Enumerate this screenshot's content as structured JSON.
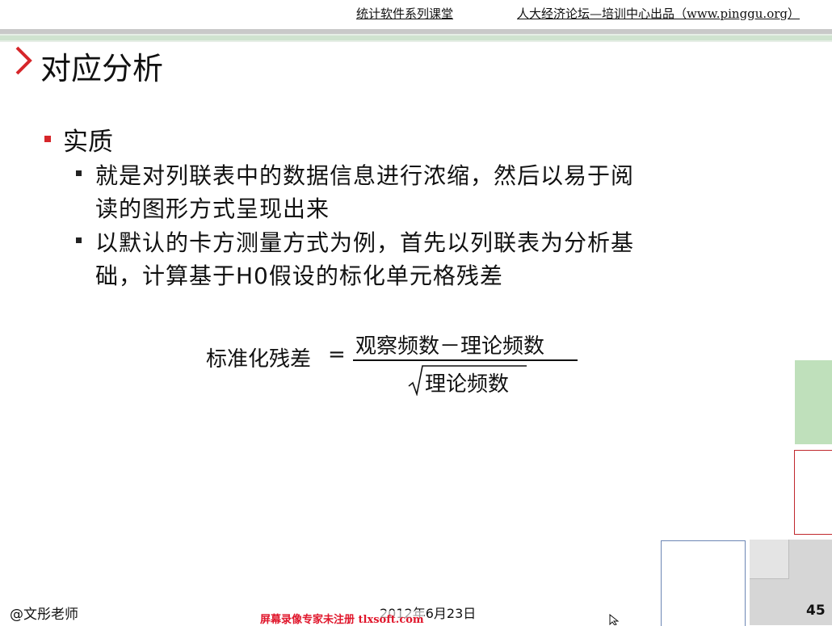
{
  "header": {
    "course": "统计软件系列课堂",
    "publisher": "人大经济论坛—培训中心出品（www.pinggu.org）"
  },
  "slide": {
    "title": "对应分析",
    "level1": [
      {
        "text": "实质"
      }
    ],
    "level2": [
      {
        "line1": "就是对列联表中的数据信息进行浓缩，然后以易于阅",
        "line2": "读的图形方式呈现出来"
      },
      {
        "line1": "以默认的卡方测量方式为例，首先以列联表为分析基",
        "line2": "础，计算基于H0假设的标化单元格残差"
      }
    ],
    "formula": {
      "lhs": "标准化残差",
      "equals": "=",
      "numerator": "观察频数－理论频数",
      "denominator": "理论频数"
    }
  },
  "footer": {
    "author": "@文彤老师",
    "date": "2012年6月23日",
    "watermark": "屏幕录像专家未注册 tlxsoft.com",
    "page": "45"
  },
  "colors": {
    "accent_red": "#d6262a",
    "stripe_gray": "#c9c9c9",
    "stripe_green": "#cfe3cf",
    "deco_green": "#bfe0bb",
    "deco_red_border": "#c0282d"
  }
}
